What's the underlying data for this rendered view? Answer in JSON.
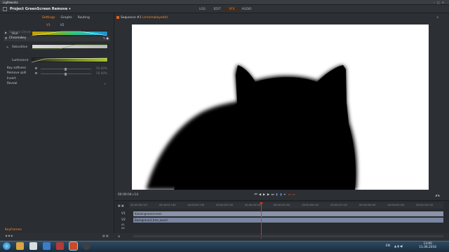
{
  "window": {
    "title": "Lightworks"
  },
  "header": {
    "project": "Project GreenScreen Remove ▾",
    "tabs": [
      {
        "label": "LOG",
        "active": false
      },
      {
        "label": "EDIT",
        "active": false
      },
      {
        "label": "VFX",
        "active": true
      },
      {
        "label": "AUDIO",
        "active": false
      }
    ]
  },
  "left_panel": {
    "subtabs": [
      {
        "label": "Settings",
        "active": true
      },
      {
        "label": "Graphs",
        "active": false
      },
      {
        "label": "Routing",
        "active": false
      }
    ],
    "video_tabs": [
      {
        "label": "V1",
        "active": true
      },
      {
        "label": "V2",
        "active": false
      }
    ],
    "fx_row": "Sample Chromakey",
    "effect": "Chromakey",
    "color_rows": [
      {
        "label": "Hue"
      },
      {
        "label": "Saturation"
      },
      {
        "label": "Luminance"
      }
    ],
    "params": [
      {
        "label": "Key softness",
        "value": "50.00%",
        "level": 0.5
      },
      {
        "label": "Remove spill",
        "value": "50.00%",
        "level": 0.5
      },
      {
        "label": "Invert",
        "value": "",
        "level": null
      },
      {
        "label": "Reveal",
        "value": "",
        "level": null
      }
    ],
    "keyframes_label": "Keyframes"
  },
  "viewer": {
    "sequence": "Sequence #1",
    "sequence_sub": "(chromakeyedit)",
    "timecode": "00:00:04+14",
    "accent": "#ff7a1a"
  },
  "timeline": {
    "ruler": [
      "00:00:00+00",
      "00:00:01+00",
      "00:00:02+00",
      "00:00:03+00",
      "00:00:04+00",
      "00:00:05+00",
      "00:00:06+00",
      "00:00:07+00",
      "00:00:08+00",
      "00:00:09+00",
      "00:00:10+00"
    ],
    "tracks": [
      {
        "label": "V1",
        "clip": "Katzengreenscreen"
      },
      {
        "label": "V2",
        "clip": "Background_tree_wood"
      },
      {
        "label": "A1",
        "clip": ""
      },
      {
        "label": "A2",
        "clip": ""
      }
    ]
  },
  "taskbar": {
    "lang": "EN",
    "time": "13:00",
    "date": "11.06.2016"
  }
}
